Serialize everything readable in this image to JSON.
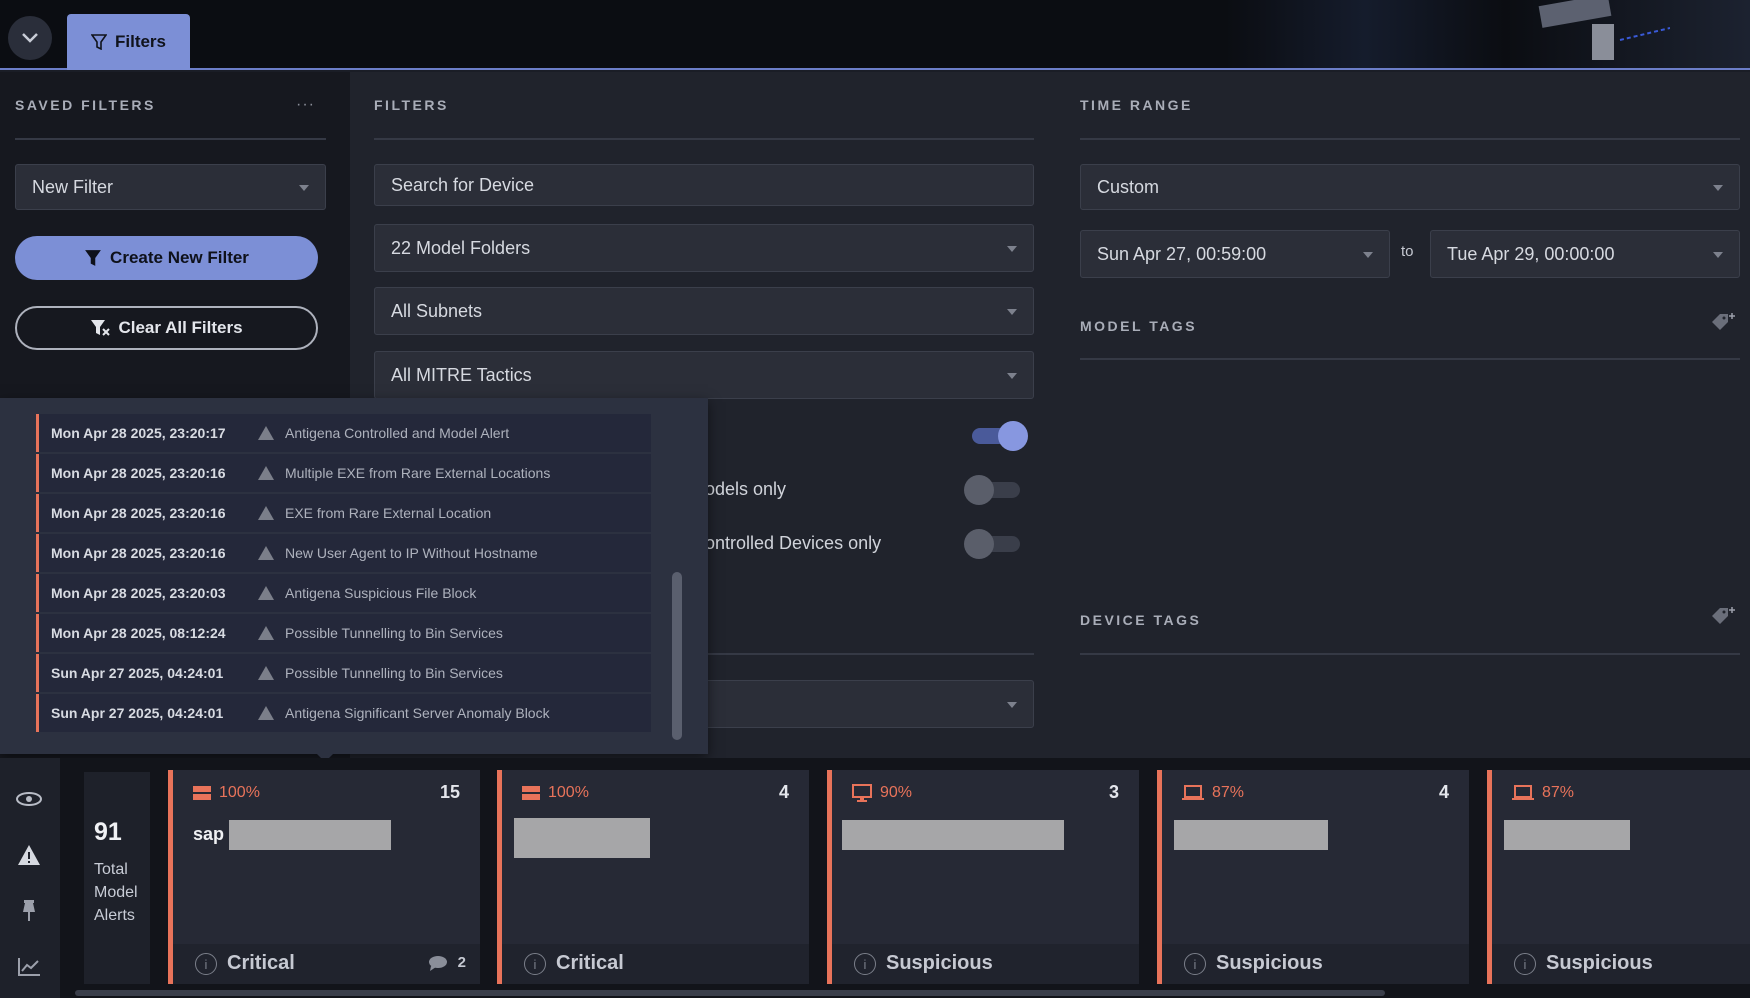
{
  "tabs": {
    "filters_label": "Filters"
  },
  "saved_filters": {
    "title": "SAVED FILTERS",
    "menu": "···",
    "selected": "New Filter",
    "create_label": "Create New Filter",
    "clear_label": "Clear All Filters"
  },
  "filters": {
    "title": "FILTERS",
    "search_placeholder": "Search for Device",
    "model_folders": "22 Model Folders",
    "subnets": "All Subnets",
    "mitre": "All MITRE Tactics",
    "toggle1_label": "",
    "toggle2_label": "odels only",
    "toggle3_label": "ontrolled Devices only",
    "toggle1_on": true,
    "toggle2_on": false,
    "toggle3_on": false
  },
  "time_range": {
    "title": "TIME RANGE",
    "selected": "Custom",
    "from": "Sun Apr 27, 00:59:00",
    "to_label": "to",
    "to": "Tue Apr 29, 00:00:00"
  },
  "model_tags": {
    "title": "MODEL TAGS"
  },
  "device_tags": {
    "title": "DEVICE TAGS"
  },
  "alert_list": [
    {
      "time": "Mon Apr 28 2025, 23:20:17",
      "name": "Antigena Controlled and Model Alert"
    },
    {
      "time": "Mon Apr 28 2025, 23:20:16",
      "name": "Multiple EXE from Rare External Locations"
    },
    {
      "time": "Mon Apr 28 2025, 23:20:16",
      "name": "EXE from Rare External Location"
    },
    {
      "time": "Mon Apr 28 2025, 23:20:16",
      "name": "New User Agent to IP Without Hostname"
    },
    {
      "time": "Mon Apr 28 2025, 23:20:03",
      "name": "Antigena Suspicious File Block"
    },
    {
      "time": "Mon Apr 28 2025, 08:12:24",
      "name": "Possible Tunnelling to Bin Services"
    },
    {
      "time": "Sun Apr 27 2025, 04:24:01",
      "name": "Possible Tunnelling to Bin Services"
    },
    {
      "time": "Sun Apr 27 2025, 04:24:01",
      "name": "Antigena Significant Server Anomaly Block"
    }
  ],
  "summary": {
    "total": "91",
    "label_line1": "Total",
    "label_line2": "Model",
    "label_line3": "Alerts"
  },
  "cards": [
    {
      "icon": "server-icon",
      "percent": "100%",
      "count": "15",
      "device": "sap",
      "severity": "Critical",
      "comments": "2"
    },
    {
      "icon": "server-icon",
      "percent": "100%",
      "count": "4",
      "device": "",
      "severity": "Critical",
      "comments": ""
    },
    {
      "icon": "desktop-icon",
      "percent": "90%",
      "count": "3",
      "device": "",
      "severity": "Suspicious",
      "comments": ""
    },
    {
      "icon": "laptop-icon",
      "percent": "87%",
      "count": "4",
      "device": "",
      "severity": "Suspicious",
      "comments": ""
    },
    {
      "icon": "laptop-icon",
      "percent": "87%",
      "count": "",
      "device": "",
      "severity": "Suspicious",
      "comments": ""
    }
  ],
  "colors": {
    "accent": "#7c8fd6",
    "alert": "#e8735a"
  }
}
